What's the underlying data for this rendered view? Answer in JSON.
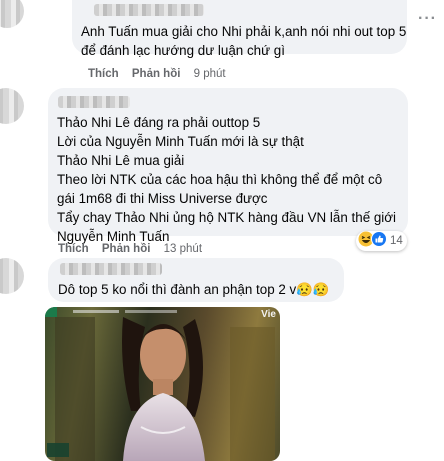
{
  "comments": [
    {
      "lines": [
        "Anh Tuấn mua giải cho Nhi phải k,anh nói nhi out top 5",
        "để đánh lạc hướng dư luận chứ gì"
      ],
      "actions": {
        "like": "Thích",
        "reply": "Phản hồi",
        "time": "9 phút"
      }
    },
    {
      "lines": [
        "Thảo Nhi Lê đáng ra phải outtop 5",
        "Lời của Nguyễn Minh Tuấn mới là sự thật",
        "Thảo Nhi Lê mua giải",
        "Theo lời NTK của các hoa hậu thì không thể để một cô",
        "gái 1m68 đi thi Miss Universe được",
        "Tẩy chay Thảo Nhi ủng hộ NTK hàng đầu VN lẫn thế giới",
        "Nguyễn Minh Tuấn"
      ],
      "actions": {
        "like": "Thích",
        "reply": "Phản hồi",
        "time": "13 phút"
      },
      "reactions": {
        "count": "14"
      }
    },
    {
      "lines": [
        "Dô top 5 ko nổi thì đành an phận top 2 v😥😥"
      ]
    }
  ],
  "video": {
    "watermark": "Vie"
  },
  "colors": {
    "bubble": "#f0f2f5",
    "text": "#050505",
    "meta": "#65676b",
    "like_blue": "#1877f2"
  }
}
